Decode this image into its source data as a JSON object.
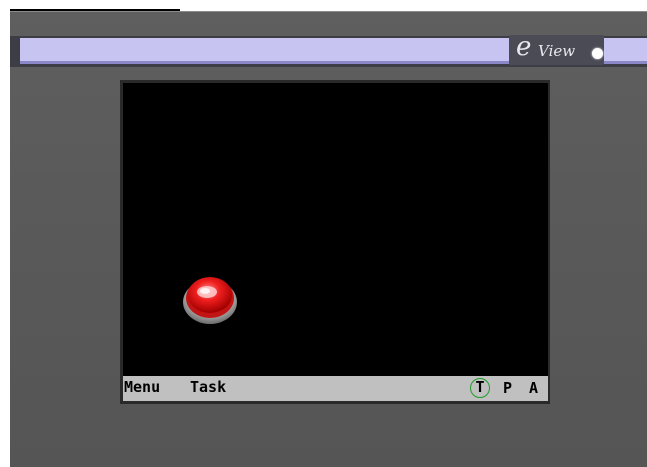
{
  "device": {
    "brand": {
      "logo_letter": "e",
      "logo_word": "View"
    },
    "colors": {
      "bezel": "#5a5a5a",
      "stripe": "#c7c4f2",
      "screen": "#000000",
      "taskbar": "#c0c0c0",
      "button_red": "#e02020",
      "active_indicator_ring": "#1f9a2a"
    }
  },
  "screen": {
    "widgets": [
      {
        "type": "push-button",
        "icon": "red-round-button-icon",
        "color": "#e02020"
      }
    ]
  },
  "taskbar": {
    "menu_label": "Menu",
    "task_label": "Task",
    "t_label": "T",
    "p_label": "P",
    "a_label": "A",
    "active_item": "T"
  }
}
